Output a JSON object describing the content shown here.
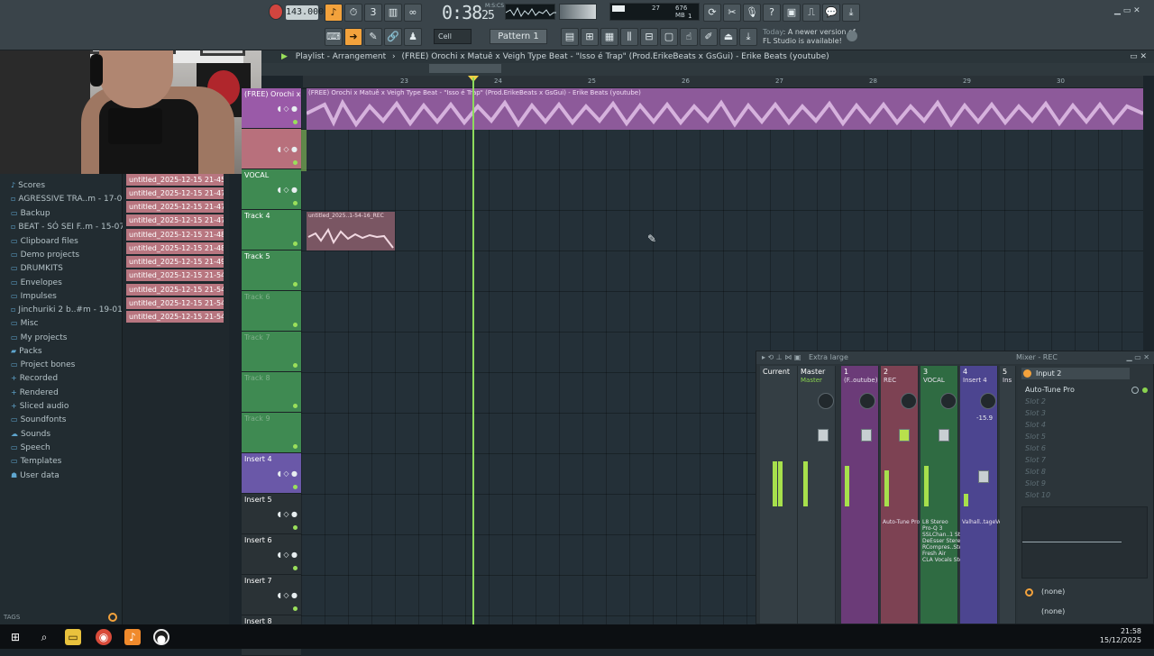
{
  "toolbar": {
    "tempo": "143.000",
    "clock": "0:38",
    "clock_sub": "25",
    "clock_label": "M:S:CS",
    "cpu": "27",
    "memory": "676 MB",
    "voices": "1",
    "snap": "Cell",
    "pattern": "Pattern 1",
    "hint_date": "Today",
    "hint_text": "A newer version of",
    "hint_text2": "FL Studio is available!"
  },
  "playlist": {
    "title": "Playlist - Arrangement",
    "breadcrumb": "(FREE) Orochi x Matuê x Veigh Type Beat - \"Isso é Trap\" (Prod.ErikeBeats x GsGui) - Erike Beats (youtube)",
    "ruler": [
      "23",
      "24",
      "25",
      "26",
      "27",
      "28",
      "29",
      "30"
    ],
    "main_clip_label": "(FREE) Orochi x Matuê x Veigh Type Beat - \"Isso é Trap\" (Prod.ErikeBeats x GsGui) - Erike Beats (youtube)",
    "small_clip_label": "untitled_2025..1-54-16_REC",
    "tracks": [
      {
        "name": "(FREE) Orochi x",
        "color": "#9a5aa8"
      },
      {
        "name": "",
        "color": "#b8707c"
      },
      {
        "name": "VOCAL",
        "color": "#3f8a52"
      },
      {
        "name": "Track 4",
        "color": "#3f8a52"
      },
      {
        "name": "Track 5",
        "color": "#3f8a52"
      },
      {
        "name": "Track 6",
        "color": "#3f8a52"
      },
      {
        "name": "Track 7",
        "color": "#3f8a52"
      },
      {
        "name": "Track 8",
        "color": "#3f8a52"
      },
      {
        "name": "Track 9",
        "color": "#3f8a52"
      },
      {
        "name": "Insert 4",
        "color": "#6a58a8"
      },
      {
        "name": "Insert 5",
        "color": "#2a3236"
      },
      {
        "name": "Insert 6",
        "color": "#2a3236"
      },
      {
        "name": "Insert 7",
        "color": "#2a3236"
      },
      {
        "name": "Insert 8",
        "color": "#2a3236"
      }
    ]
  },
  "browser": {
    "items": [
      "Scores",
      "AGRESSIVE TRA..m - 17-05-25",
      "Backup",
      "BEAT - SÓ SEI F..m - 15-07-25",
      "Clipboard files",
      "Demo projects",
      "DRUMKITS",
      "Envelopes",
      "Impulses",
      "Jinchuriki 2 b..#m - 19-01-25",
      "Misc",
      "My projects",
      "Packs",
      "Project bones",
      "Recorded",
      "Rendered",
      "Sliced audio",
      "Soundfonts",
      "Sounds",
      "Speech",
      "Templates",
      "User data"
    ],
    "tags_label": "TAGS"
  },
  "files": [
    "untitled_2025-12-15 21-45-46...",
    "untitled_2025-12-15 21-47-15...",
    "untitled_2025-12-15 21-47-21...",
    "untitled_2025-12-15 21-47-31...",
    "untitled_2025-12-15 21-48-26...",
    "untitled_2025-12-15 21-48-48...",
    "untitled_2025-12-15 21-49-17...",
    "untitled_2025-12-15 21-54-01...",
    "untitled_2025-12-15 21-54-07...",
    "untitled_2025-12-15 21-54-12...",
    "untitled_2025-12-15 21-54-16..."
  ],
  "mixer": {
    "title": "Mixer - REC",
    "size_label": "Extra large",
    "strips": [
      {
        "num": "",
        "name": "Current",
        "sub": "",
        "color": "#343e44"
      },
      {
        "num": "",
        "name": "Master",
        "sub": "Master",
        "color": "#343e44"
      },
      {
        "num": "1",
        "name": "",
        "sub": "(F..outube)",
        "color": "#6b3b78"
      },
      {
        "num": "2",
        "name": "",
        "sub": "REC",
        "color": "#7d4253"
      },
      {
        "num": "3",
        "name": "",
        "sub": "VOCAL",
        "color": "#2f6b42"
      },
      {
        "num": "4",
        "name": "",
        "sub": "Insert 4",
        "color": "#4c4590"
      },
      {
        "num": "5",
        "name": "",
        "sub": "Ins",
        "color": "#343e44"
      }
    ],
    "level_readout": "-15.9",
    "fx_rec": "Auto-Tune Pro",
    "fx_vocal": [
      "L8 Stereo",
      "Pro-Q 3",
      "SSLChan..1 Stereo",
      "DeEsser Stereo",
      "RCompres..Stereo",
      "Fresh Air",
      "CLA Vocals Stereo"
    ],
    "fx_insert4": "Valhall..tageVerb",
    "input": "Input 2",
    "slots": [
      "Auto-Tune Pro",
      "Slot 2",
      "Slot 3",
      "Slot 4",
      "Slot 5",
      "Slot 6",
      "Slot 7",
      "Slot 8",
      "Slot 9",
      "Slot 10"
    ],
    "out1": "(none)",
    "out2": "(none)"
  },
  "taskbar": {
    "time": "21:58",
    "date": "15/12/2025"
  }
}
